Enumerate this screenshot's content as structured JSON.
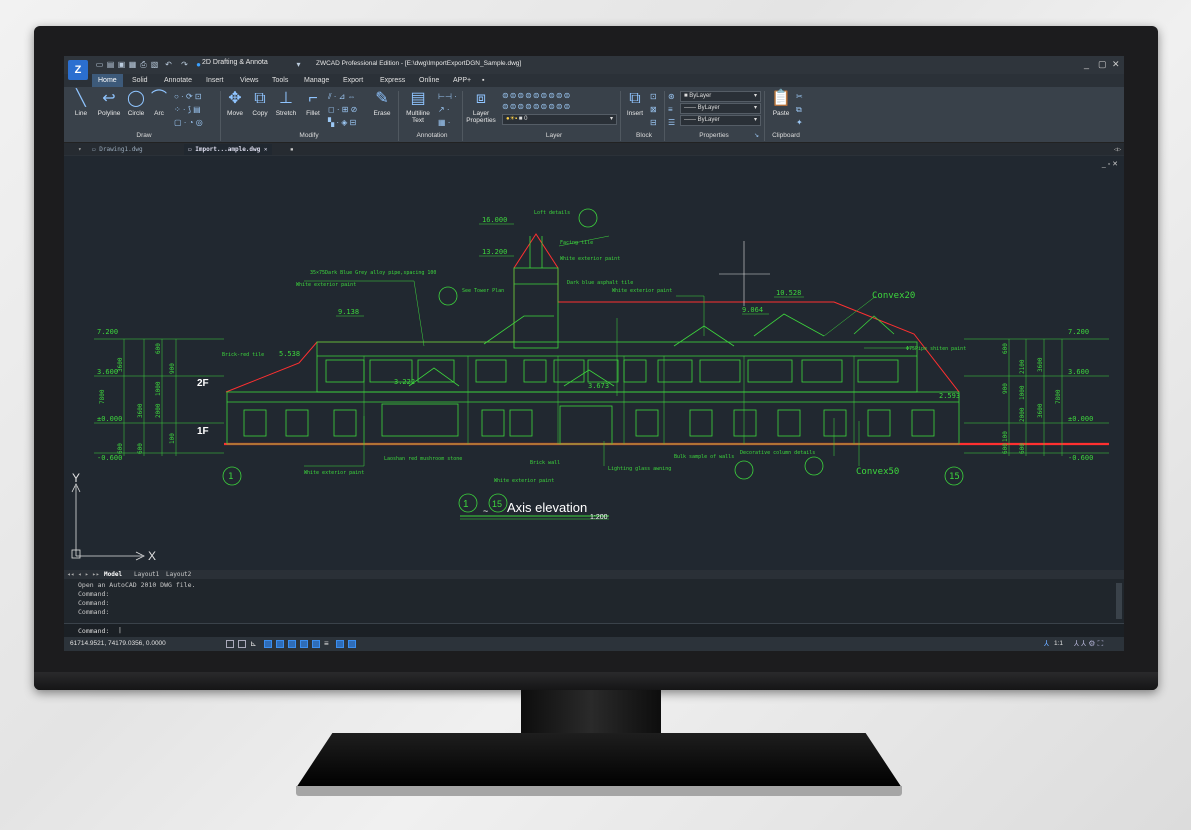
{
  "app": {
    "workspace": "2D Drafting & Annota",
    "window_title": "ZWCAD Professional Edition - [E:\\dwg\\ImportExportDGN_Sample.dwg]"
  },
  "menu_tabs": [
    "Home",
    "Solid",
    "Annotate",
    "Insert",
    "Views",
    "Tools",
    "Manage",
    "Export",
    "Express",
    "Online",
    "APP+"
  ],
  "ribbon": {
    "draw": {
      "buttons": [
        "Line",
        "Polyline",
        "Circle",
        "Arc"
      ],
      "group": "Draw"
    },
    "modify": {
      "buttons": [
        "Move",
        "Copy",
        "Stretch",
        "Fillet",
        "Erase"
      ],
      "group": "Modify"
    },
    "annotation": {
      "buttons": [
        "Multiline\nText"
      ],
      "group": "Annotation"
    },
    "layer": {
      "buttons": [
        "Layer\nProperties"
      ],
      "current": "0",
      "group": "Layer"
    },
    "block": {
      "buttons": [
        "Insert"
      ],
      "group": "Block"
    },
    "properties": {
      "values": [
        "ByLayer",
        "ByLayer",
        "ByLayer"
      ],
      "group": "Properties"
    },
    "clipboard": {
      "buttons": [
        "Paste"
      ],
      "group": "Clipboard"
    }
  },
  "doc_tabs": [
    "Drawing1.dwg",
    "Import...ample.dwg"
  ],
  "drawing": {
    "elev_labels": [
      "16.000",
      "13.200",
      "10.528",
      "9.138",
      "9.064",
      "7.200",
      "3.600",
      "±0.000",
      "-0.600",
      "5.538",
      "3.222",
      "3.673",
      "2.593",
      "7.200",
      "3.600",
      "±0.000",
      "-0.600"
    ],
    "floor_labels": [
      "2F",
      "1F"
    ],
    "axis_markers": [
      "1",
      "15"
    ],
    "annotations": [
      "Loft details",
      "Facing tile",
      "White exterior paint",
      "35×75Dark Blue Grey alloy pipe,spacing 100",
      "White exterior paint",
      "See Tower Plan",
      "Dark blue asphalt tile",
      "White exterior paint",
      "Convex20",
      "Brick-red tile",
      "Φ75Pipe shiten paint",
      "Laoshan red mushroom stone",
      "White exterior paint",
      "Brick wall",
      "White exterior paint",
      "Lighting glass awning",
      "Bulk sample of walls",
      "Decorative column details",
      "Convex50"
    ],
    "title": "Axis elevation",
    "scale": "1:200",
    "title_axes": [
      "1",
      "15"
    ],
    "dims_left": [
      "3600",
      "3600",
      "600",
      "600",
      "7800",
      "100",
      "2000",
      "1000",
      "900",
      "600"
    ],
    "dims_right": [
      "600",
      "2100",
      "3600",
      "900",
      "1000",
      "2000",
      "3600",
      "7800",
      "100",
      "600",
      "600"
    ],
    "ucs": {
      "x": "X",
      "y": "Y"
    }
  },
  "layout_tabs": [
    "Model",
    "Layout1",
    "Layout2"
  ],
  "command_history": [
    "Open an AutoCAD 2010 DWG file.",
    "Command:",
    "Command:",
    "Command:"
  ],
  "command_prompt": "Command:",
  "status": {
    "coords": "61714.9521, 74179.0356, 0.0000",
    "scale": "1:1"
  },
  "colors": {
    "line": "#3dd63d",
    "red": "#ff3030",
    "bg": "#212830"
  }
}
